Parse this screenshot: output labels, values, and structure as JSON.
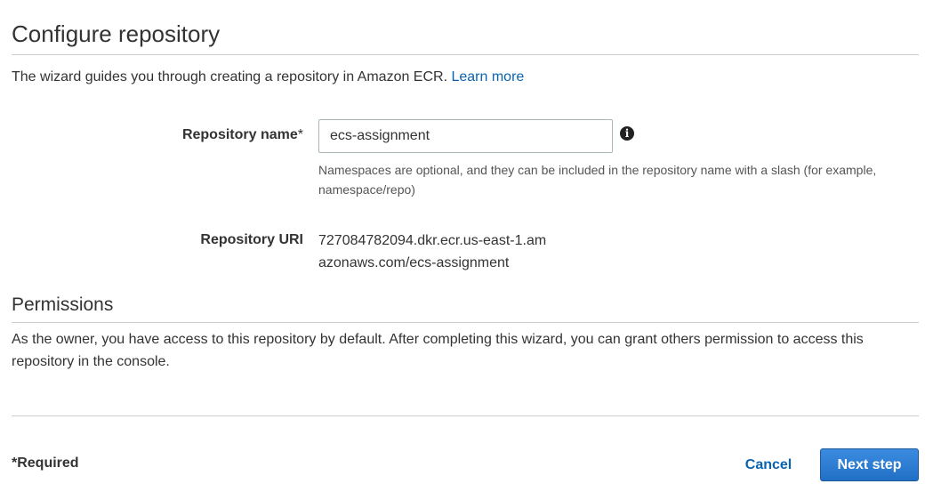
{
  "header": {
    "title": "Configure repository",
    "intro_text": "The wizard guides you through creating a repository in Amazon ECR. ",
    "learn_more_link": "Learn more"
  },
  "form": {
    "repository_name": {
      "label": "Repository name",
      "required_marker": "*",
      "value": "ecs-assignment",
      "info_icon": "info-circle-icon",
      "hint": "Namespaces are optional, and they can be included in the repository name with a slash (for example, namespace/repo)"
    },
    "repository_uri": {
      "label": "Repository URI",
      "value": "727084782094.dkr.ecr.us-east-1.amazonaws.com/ecs-assignment"
    }
  },
  "permissions": {
    "title": "Permissions",
    "text": "As the owner, you have access to this repository by default. After completing this wizard, you can grant others permission to access this repository in the console."
  },
  "footer": {
    "required_note": "*Required",
    "cancel_label": "Cancel",
    "next_label": "Next step"
  },
  "colors": {
    "link": "#0a63b0",
    "primary_button": "#2170c6",
    "text": "#333333",
    "divider": "#cccccc"
  }
}
